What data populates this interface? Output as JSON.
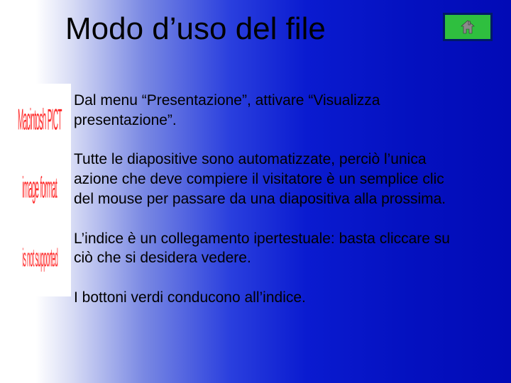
{
  "title": "Modo d’uso del file",
  "home_button": {
    "name": "home-icon"
  },
  "side_image": {
    "line1": "Macintosh PICT",
    "line2": "image format",
    "line3": "is not supported"
  },
  "body": {
    "p1": "Dal menu “Presentazione”, attivare “Visualizza presentazione”.",
    "p2": "Tutte le diapositive sono automatizzate, perciò l’unica azione che deve compiere il visitatore è un semplice clic del mouse per passare da una diapositiva alla prossima.",
    "p3": "L’indice è un collegamento ipertestuale: basta cliccare su ciò che si desidera vedere.",
    "p4": "I bottoni verdi conducono all’indice."
  }
}
